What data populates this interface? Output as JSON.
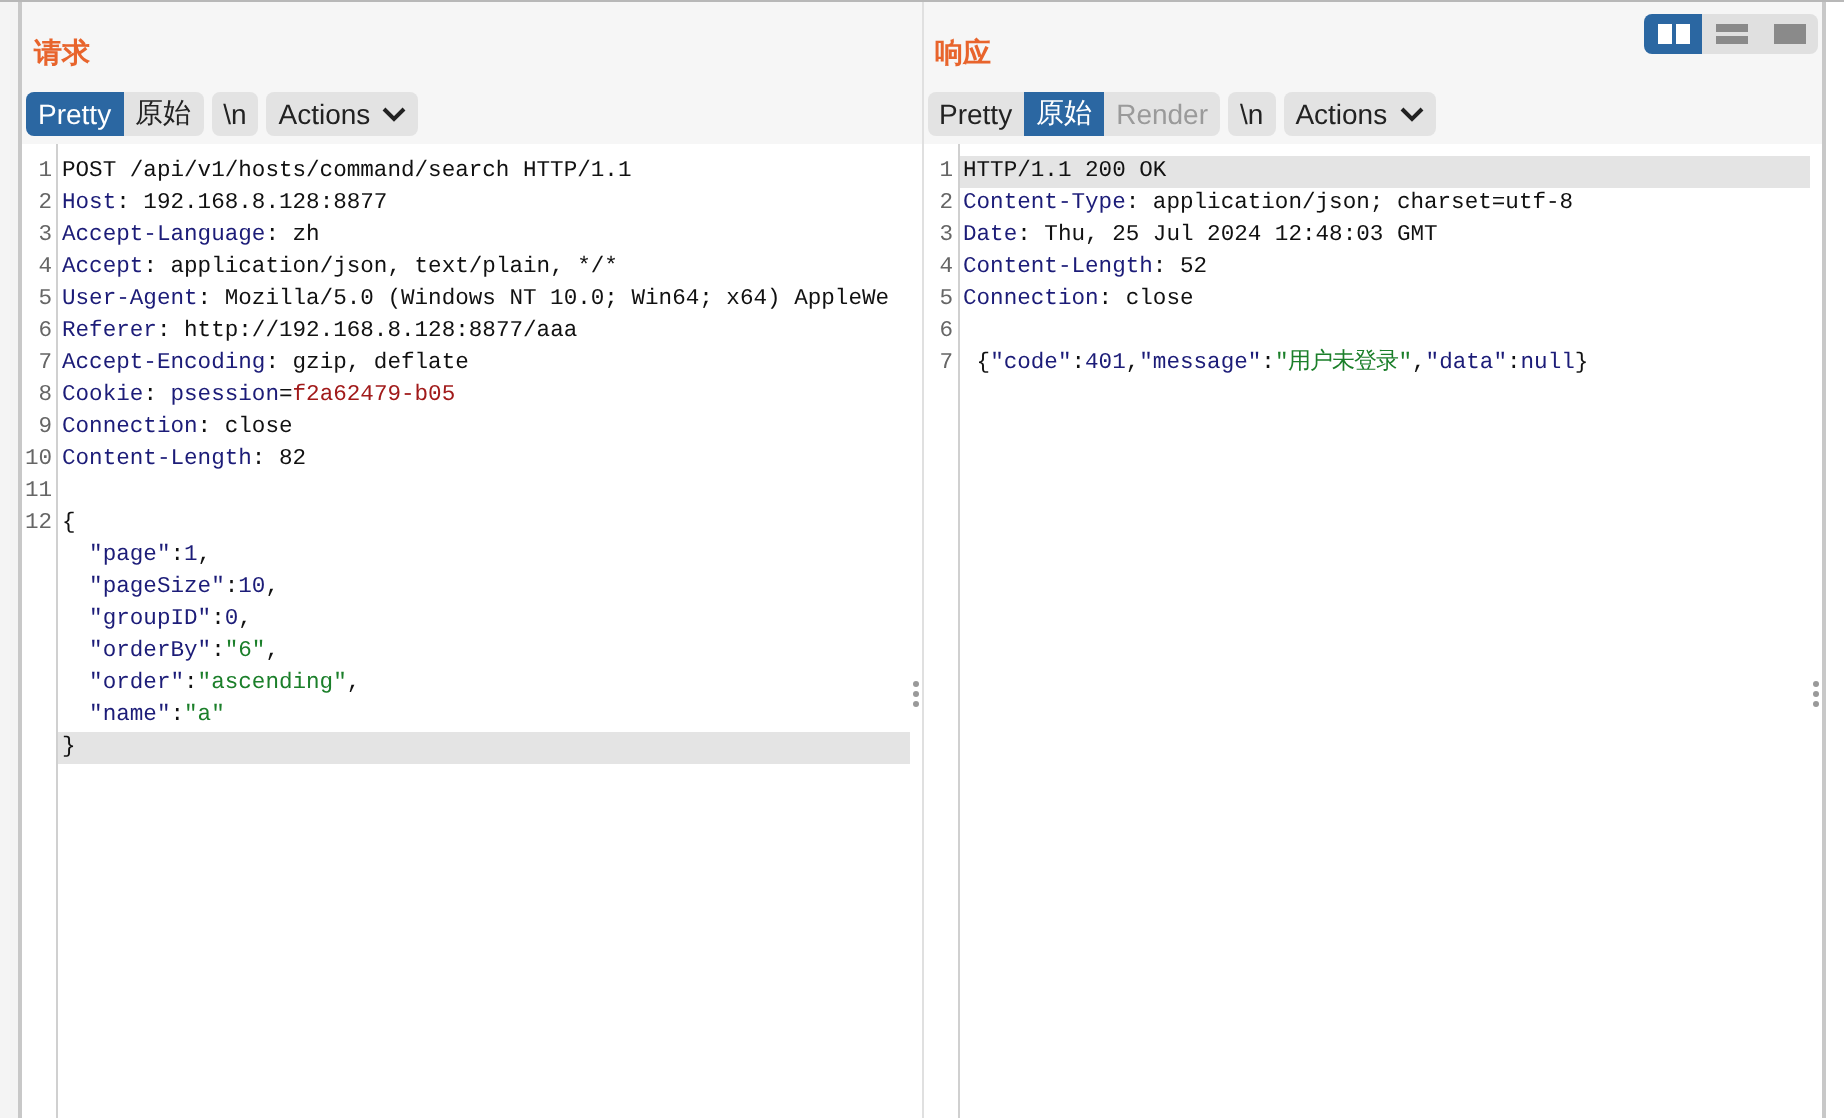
{
  "layout_toggle": [
    {
      "kind": "split",
      "selected": true
    },
    {
      "kind": "stacked",
      "selected": false
    },
    {
      "kind": "single",
      "selected": false
    }
  ],
  "panes": [
    {
      "title": "请求",
      "view_tabs": [
        {
          "label": "Pretty",
          "selected": true,
          "disabled": false
        },
        {
          "label": "原始",
          "selected": false,
          "disabled": false
        }
      ],
      "newline_button": "\\n",
      "actions_button": "Actions",
      "lines": [
        {
          "number": "1",
          "highlighted": false,
          "segments": [
            {
              "kind": "plain",
              "text": "POST /api/v1/hosts/command/search HTTP/1.1"
            }
          ]
        },
        {
          "number": "2",
          "highlighted": false,
          "segments": [
            {
              "kind": "name",
              "text": "Host"
            },
            {
              "kind": "plain",
              "text": ": 192.168.8.128:8877"
            }
          ]
        },
        {
          "number": "3",
          "highlighted": false,
          "segments": [
            {
              "kind": "name",
              "text": "Accept-Language"
            },
            {
              "kind": "plain",
              "text": ": zh"
            }
          ]
        },
        {
          "number": "4",
          "highlighted": false,
          "segments": [
            {
              "kind": "name",
              "text": "Accept"
            },
            {
              "kind": "plain",
              "text": ": application/json, text/plain, */*"
            }
          ]
        },
        {
          "number": "5",
          "highlighted": false,
          "segments": [
            {
              "kind": "name",
              "text": "User-Agent"
            },
            {
              "kind": "plain",
              "text": ": Mozilla/5.0 (Windows NT 10.0; Win64; x64) AppleWe"
            }
          ]
        },
        {
          "number": "6",
          "highlighted": false,
          "segments": [
            {
              "kind": "name",
              "text": "Referer"
            },
            {
              "kind": "plain",
              "text": ": http://192.168.8.128:8877/aaa"
            }
          ]
        },
        {
          "number": "7",
          "highlighted": false,
          "segments": [
            {
              "kind": "name",
              "text": "Accept-Encoding"
            },
            {
              "kind": "plain",
              "text": ": gzip, deflate"
            }
          ]
        },
        {
          "number": "8",
          "highlighted": false,
          "segments": [
            {
              "kind": "name",
              "text": "Cookie"
            },
            {
              "kind": "plain",
              "text": ": "
            },
            {
              "kind": "name",
              "text": "psession"
            },
            {
              "kind": "plain",
              "text": "="
            },
            {
              "kind": "cookie",
              "text": "f2a62479-b05"
            }
          ]
        },
        {
          "number": "9",
          "highlighted": false,
          "segments": [
            {
              "kind": "name",
              "text": "Connection"
            },
            {
              "kind": "plain",
              "text": ": close"
            }
          ]
        },
        {
          "number": "10",
          "highlighted": false,
          "segments": [
            {
              "kind": "name",
              "text": "Content-Length"
            },
            {
              "kind": "plain",
              "text": ": 82"
            }
          ]
        },
        {
          "number": "11",
          "highlighted": false
        },
        {
          "number": "12",
          "highlighted": false,
          "segments": [
            {
              "kind": "plain",
              "text": "{"
            }
          ]
        },
        {
          "highlighted": false,
          "segments": [
            {
              "kind": "name",
              "text": "  \"page\""
            },
            {
              "kind": "plain",
              "text": ":"
            },
            {
              "kind": "num",
              "text": "1"
            },
            {
              "kind": "plain",
              "text": ","
            }
          ]
        },
        {
          "highlighted": false,
          "segments": [
            {
              "kind": "name",
              "text": "  \"pageSize\""
            },
            {
              "kind": "plain",
              "text": ":"
            },
            {
              "kind": "num",
              "text": "10"
            },
            {
              "kind": "plain",
              "text": ","
            }
          ]
        },
        {
          "highlighted": false,
          "segments": [
            {
              "kind": "name",
              "text": "  \"groupID\""
            },
            {
              "kind": "plain",
              "text": ":"
            },
            {
              "kind": "num",
              "text": "0"
            },
            {
              "kind": "plain",
              "text": ","
            }
          ]
        },
        {
          "highlighted": false,
          "segments": [
            {
              "kind": "name",
              "text": "  \"orderBy\""
            },
            {
              "kind": "plain",
              "text": ":"
            },
            {
              "kind": "str",
              "text": "\"6\""
            },
            {
              "kind": "plain",
              "text": ","
            }
          ]
        },
        {
          "highlighted": false,
          "segments": [
            {
              "kind": "name",
              "text": "  \"order\""
            },
            {
              "kind": "plain",
              "text": ":"
            },
            {
              "kind": "str",
              "text": "\"ascending\""
            },
            {
              "kind": "plain",
              "text": ","
            }
          ]
        },
        {
          "highlighted": false,
          "segments": [
            {
              "kind": "name",
              "text": "  \"name\""
            },
            {
              "kind": "plain",
              "text": ":"
            },
            {
              "kind": "str",
              "text": "\"a\""
            }
          ]
        },
        {
          "highlighted": true,
          "segments": [
            {
              "kind": "plain",
              "text": "}"
            }
          ]
        }
      ]
    },
    {
      "title": "响应",
      "view_tabs": [
        {
          "label": "Pretty",
          "selected": false,
          "disabled": false
        },
        {
          "label": "原始",
          "selected": true,
          "disabled": false
        },
        {
          "label": "Render",
          "selected": false,
          "disabled": true
        }
      ],
      "newline_button": "\\n",
      "actions_button": "Actions",
      "lines": [
        {
          "number": "1",
          "highlighted": true,
          "segments": [
            {
              "kind": "plain",
              "text": "HTTP/1.1 200 OK"
            }
          ]
        },
        {
          "number": "2",
          "highlighted": false,
          "segments": [
            {
              "kind": "name",
              "text": "Content-Type"
            },
            {
              "kind": "plain",
              "text": ": application/json; charset=utf-8"
            }
          ]
        },
        {
          "number": "3",
          "highlighted": false,
          "segments": [
            {
              "kind": "name",
              "text": "Date"
            },
            {
              "kind": "plain",
              "text": ": Thu, 25 Jul 2024 12:48:03 GMT"
            }
          ]
        },
        {
          "number": "4",
          "highlighted": false,
          "segments": [
            {
              "kind": "name",
              "text": "Content-Length"
            },
            {
              "kind": "plain",
              "text": ": 52"
            }
          ]
        },
        {
          "number": "5",
          "highlighted": false,
          "segments": [
            {
              "kind": "name",
              "text": "Connection"
            },
            {
              "kind": "plain",
              "text": ": close"
            }
          ]
        },
        {
          "number": "6",
          "highlighted": false
        },
        {
          "number": "7",
          "highlighted": false,
          "segments": [
            {
              "kind": "plain",
              "text": " {"
            },
            {
              "kind": "name",
              "text": "\"code\""
            },
            {
              "kind": "plain",
              "text": ":"
            },
            {
              "kind": "num",
              "text": "401"
            },
            {
              "kind": "plain",
              "text": ","
            },
            {
              "kind": "name",
              "text": "\"message\""
            },
            {
              "kind": "plain",
              "text": ":"
            },
            {
              "kind": "str",
              "text": "\"用户未登录\""
            },
            {
              "kind": "plain",
              "text": ","
            },
            {
              "kind": "name",
              "text": "\"data\""
            },
            {
              "kind": "plain",
              "text": ":"
            },
            {
              "kind": "num",
              "text": "null"
            },
            {
              "kind": "plain",
              "text": "}"
            }
          ]
        }
      ]
    }
  ]
}
